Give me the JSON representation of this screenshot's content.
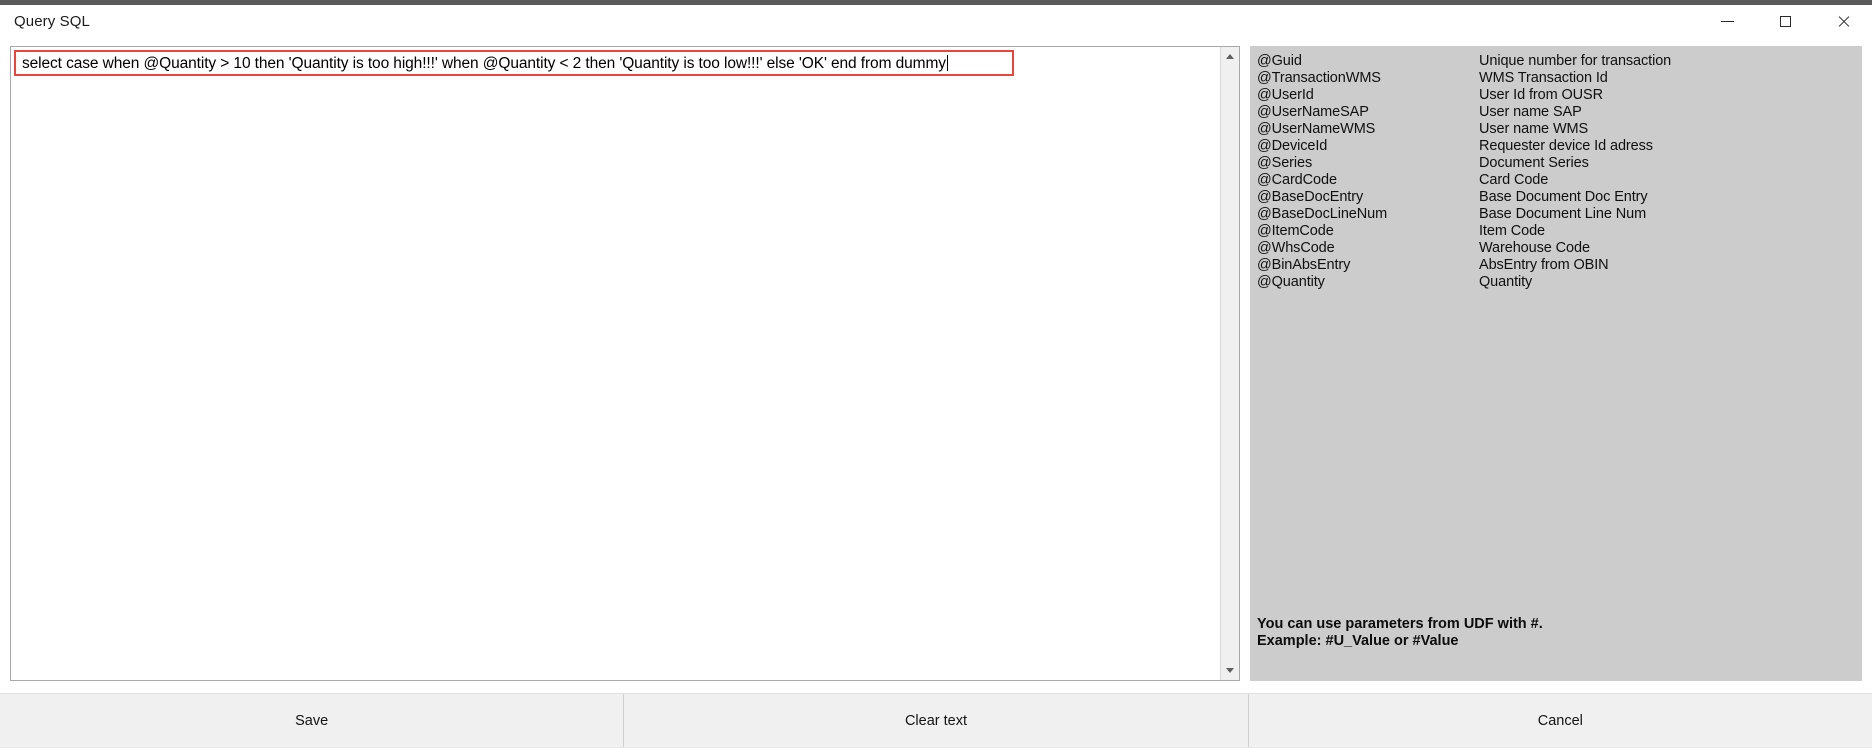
{
  "window": {
    "title": "Query SQL",
    "controls": {
      "minimize": "minimize",
      "maximize": "maximize",
      "close": "close"
    }
  },
  "editor": {
    "sql_value": "select case when @Quantity > 10 then 'Quantity is too high!!!' when @Quantity < 2 then 'Quantity is too low!!!' else 'OK' end from dummy",
    "placeholder": "",
    "highlight_color": "#e8453c"
  },
  "params_panel": {
    "background": "#cccccc",
    "rows": [
      {
        "name": "@Guid",
        "desc": "Unique number for transaction"
      },
      {
        "name": "@TransactionWMS",
        "desc": "WMS Transaction Id"
      },
      {
        "name": "@UserId",
        "desc": "User Id from OUSR"
      },
      {
        "name": "@UserNameSAP",
        "desc": "User name SAP"
      },
      {
        "name": "@UserNameWMS",
        "desc": "User name WMS"
      },
      {
        "name": "@DeviceId",
        "desc": "Requester device Id adress"
      },
      {
        "name": "@Series",
        "desc": "Document Series"
      },
      {
        "name": "@CardCode",
        "desc": "Card Code"
      },
      {
        "name": "@BaseDocEntry",
        "desc": "Base Document Doc Entry"
      },
      {
        "name": "@BaseDocLineNum",
        "desc": "Base Document Line Num"
      },
      {
        "name": "@ItemCode",
        "desc": "Item Code"
      },
      {
        "name": "@WhsCode",
        "desc": "Warehouse Code"
      },
      {
        "name": "@BinAbsEntry",
        "desc": "AbsEntry from OBIN"
      },
      {
        "name": "@Quantity",
        "desc": "Quantity"
      }
    ],
    "note_line1": "You can use parameters from UDF with #.",
    "note_line2": "Example: #U_Value or #Value"
  },
  "footer": {
    "save_label": "Save",
    "clear_label": "Clear text",
    "cancel_label": "Cancel"
  }
}
